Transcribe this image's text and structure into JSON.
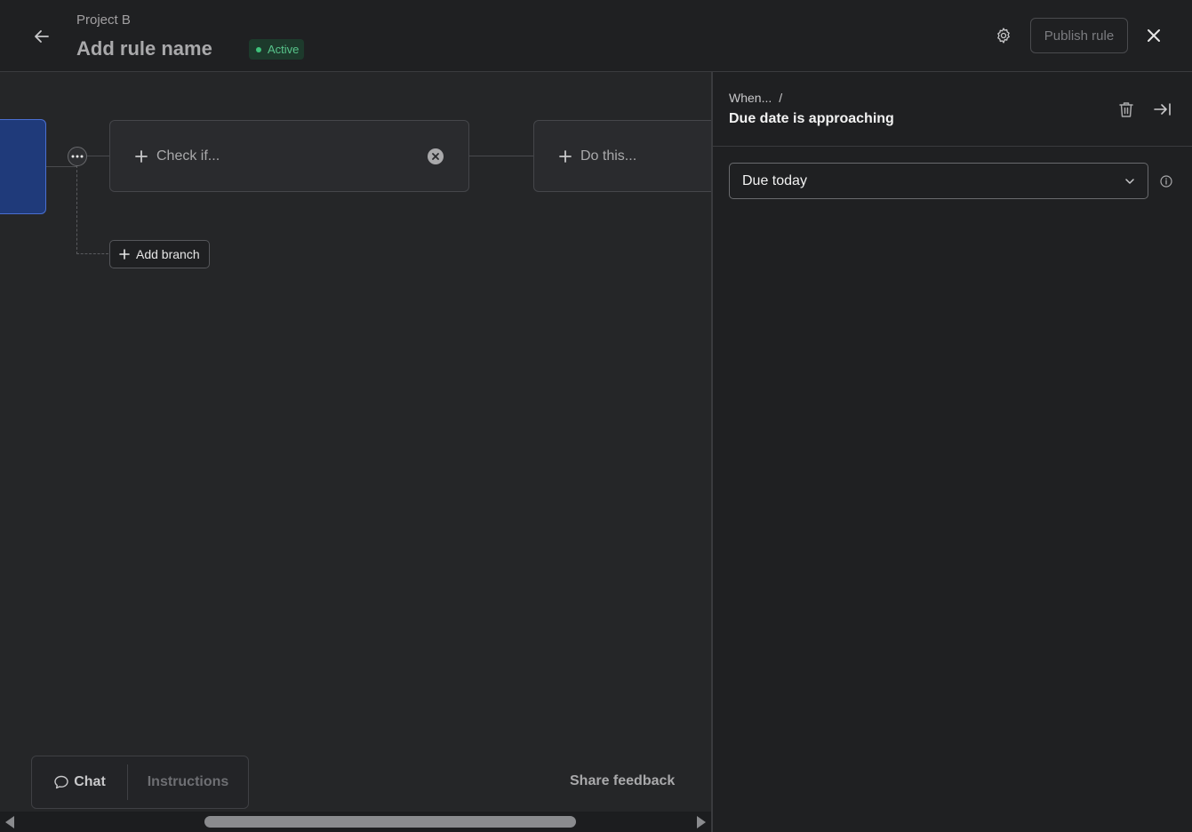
{
  "header": {
    "project": "Project B",
    "rule_name": "Add rule name",
    "status": "Active",
    "publish_label": "Publish rule"
  },
  "canvas": {
    "check_label": "Check if...",
    "do_label": "Do this...",
    "add_branch_label": "Add branch"
  },
  "bottom": {
    "chat_label": "Chat",
    "instructions_label": "Instructions",
    "share_feedback_label": "Share feedback"
  },
  "panel": {
    "breadcrumb": "When...",
    "breadcrumb_sep": "/",
    "title": "Due date is approaching",
    "select_value": "Due today"
  },
  "icons": {
    "back": "arrow-left-icon",
    "settings": "gear-icon",
    "close": "close-icon",
    "more": "more-horizontal-icon",
    "plus": "plus-icon",
    "remove": "remove-circle-icon",
    "chat": "chat-bubble-icon",
    "trash": "trash-icon",
    "collapse": "collapse-panel-icon",
    "chevron": "chevron-down-icon",
    "info": "info-icon"
  },
  "colors": {
    "accent_active": "#3ec27a",
    "trigger_node": "#1f3a7a"
  }
}
